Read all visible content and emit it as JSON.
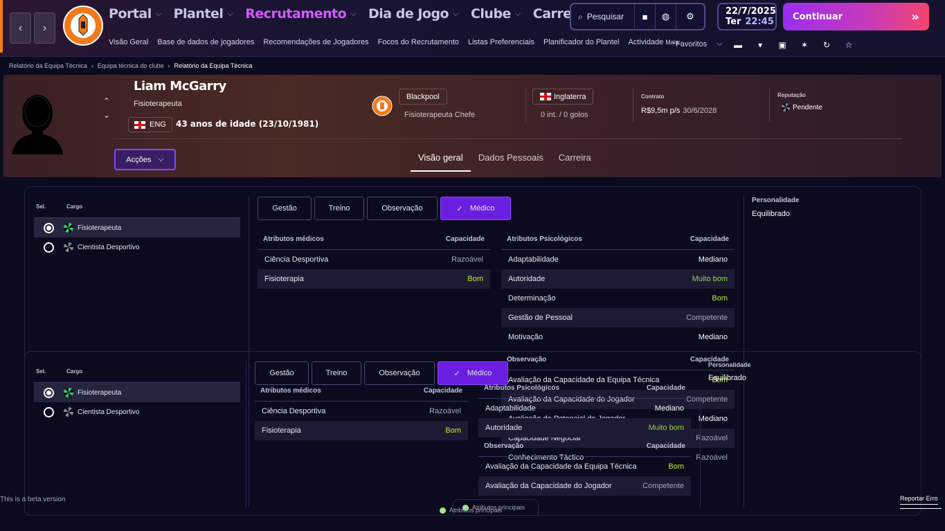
{
  "header": {
    "nav_items": [
      {
        "label": "Portal",
        "active": false
      },
      {
        "label": "Plantel",
        "active": false
      },
      {
        "label": "Recrutamento",
        "active": true
      },
      {
        "label": "Dia de Jogo",
        "active": false
      },
      {
        "label": "Clube",
        "active": false
      },
      {
        "label": "Carreira",
        "active": false
      }
    ],
    "sub_nav": [
      "Visão Geral",
      "Base de dados de jogadores",
      "Recomendações de Jogadores",
      "Focos do Recrutamento",
      "Listas Preferenciais",
      "Planificador do Plantel",
      "Actividade"
    ],
    "more_label": "Mais",
    "search_label": "Pesquisar",
    "date": "22/7/2025",
    "weekday": "Ter",
    "time": "22:45",
    "continue_label": "Continuar",
    "favorites_label": "Favoritos",
    "club_crest_text": "BLACKPOOL FOOTBALL CLUB",
    "accent_color": "#d25bff"
  },
  "breadcrumb": [
    "Relatório da Equipa Técnica",
    "Equipa técnica do clube",
    "Relatório da Equipa Técnica"
  ],
  "staff": {
    "name": "Liam McGarry",
    "role": "Fisioterapeuta",
    "nationality_code": "ENG",
    "age_text": "43 anos de idade (23/10/1981)",
    "club": "Blackpool",
    "club_role": "Fisioterapeuta Chefe",
    "country": "Inglaterra",
    "caps": "0 int. / 0 golos",
    "contract_label": "Contrato",
    "contract_wage": "R$9,5m p/s",
    "contract_end": "30/6/2028",
    "reputation_label": "Reputação",
    "reputation_value": "Pendente",
    "actions_label": "Acções",
    "tabs": [
      {
        "label": "Visão geral",
        "active": true
      },
      {
        "label": "Dados Pessoais",
        "active": false
      },
      {
        "label": "Carreira",
        "active": false
      }
    ]
  },
  "roles": {
    "col_sel": "Sel.",
    "col_role": "Cargo",
    "items": [
      {
        "label": "Fisioterapeuta",
        "selected": true
      },
      {
        "label": "Cientista Desportivo",
        "selected": false
      }
    ]
  },
  "attr_tabs": [
    {
      "label": "Gestão",
      "active": false
    },
    {
      "label": "Treino",
      "active": false
    },
    {
      "label": "Observação",
      "active": false
    },
    {
      "label": "Médico",
      "active": true
    }
  ],
  "medical": {
    "title": "Atributos médicos",
    "col": "Capacidade",
    "rows": [
      {
        "name": "Ciência Desportiva",
        "value": "Razoável",
        "q": "razoavel"
      },
      {
        "name": "Fisioterapia",
        "value": "Bom",
        "q": "bom"
      }
    ]
  },
  "psych": {
    "title": "Atributos Psicológicos",
    "col": "Capacidade",
    "rows": [
      {
        "name": "Adaptabilidade",
        "value": "Mediano",
        "q": "mediano"
      },
      {
        "name": "Autoridade",
        "value": "Muito bom",
        "q": "muitobom"
      },
      {
        "name": "Determinação",
        "value": "Bom",
        "q": "bom"
      },
      {
        "name": "Gestão de Pessoal",
        "value": "Competente",
        "q": "competente"
      },
      {
        "name": "Motivação",
        "value": "Mediano",
        "q": "mediano"
      }
    ]
  },
  "scouting": {
    "title": "Observação",
    "col": "Capacidade",
    "rows": [
      {
        "name": "Avaliação da Capacidade da Equipa Técnica",
        "value": "Bom",
        "q": "bom"
      },
      {
        "name": "Avaliação da Capacidade do Jogador",
        "value": "Competente",
        "q": "competente"
      },
      {
        "name": "Avaliação do Potencial do Jogador",
        "value": "Mediano",
        "q": "mediano"
      },
      {
        "name": "Capacidade Negocial",
        "value": "Razoável",
        "q": "razoavel"
      },
      {
        "name": "Conhecimento Táctico",
        "value": "Razoável",
        "q": "razoavel"
      }
    ]
  },
  "personality": {
    "label": "Personalidade",
    "value": "Equilibrado"
  },
  "footer": {
    "beta": "This is a beta version",
    "report": "Reportar Erro",
    "key_attrs": "Atributos principais"
  }
}
